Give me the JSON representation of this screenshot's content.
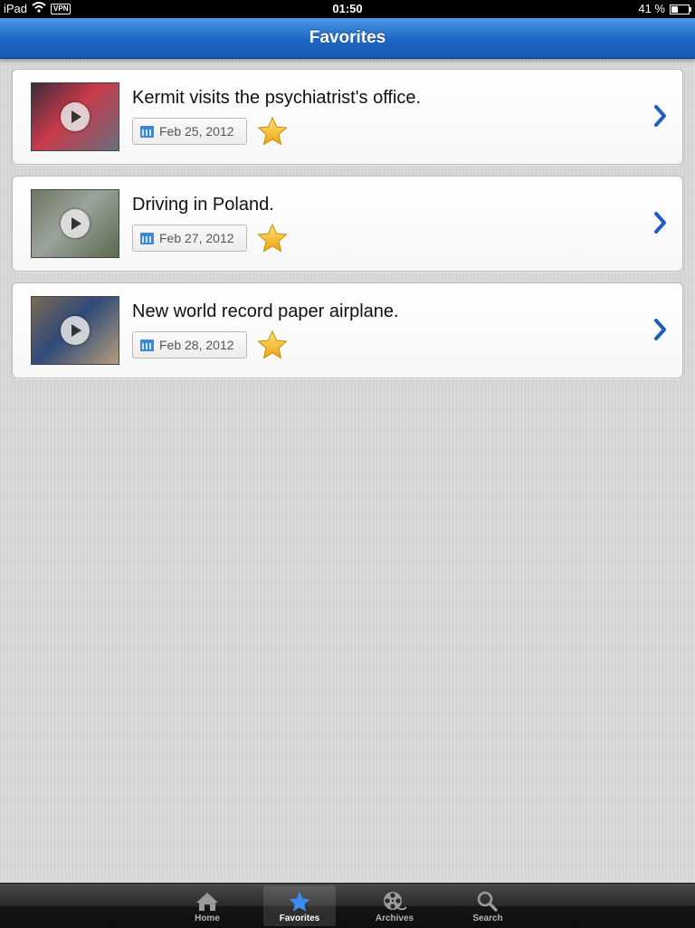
{
  "status_bar": {
    "device": "iPad",
    "vpn": "VPN",
    "time": "01:50",
    "battery": "41 %",
    "battery_level": 0.41
  },
  "nav": {
    "title": "Favorites"
  },
  "favorites": [
    {
      "title": "Kermit visits the psychiatrist's office.",
      "date": "Feb 25, 2012",
      "thumb_colors": [
        "#3b2c3a",
        "#c83a4a",
        "#6a6f7f"
      ]
    },
    {
      "title": "Driving in Poland.",
      "date": "Feb 27, 2012",
      "thumb_colors": [
        "#6c7761",
        "#9aa39a",
        "#5a6a4e"
      ]
    },
    {
      "title": "New world record paper airplane.",
      "date": "Feb 28, 2012",
      "thumb_colors": [
        "#7d6a52",
        "#2f4a7a",
        "#b59d7c"
      ]
    }
  ],
  "tabs": [
    {
      "label": "Home",
      "icon": "home-icon"
    },
    {
      "label": "Favorites",
      "icon": "star-icon",
      "active": true
    },
    {
      "label": "Archives",
      "icon": "film-reel-icon"
    },
    {
      "label": "Search",
      "icon": "magnifier-icon"
    }
  ],
  "colors": {
    "accent": "#1d66c4",
    "star": "#f5b81c",
    "chevron": "#1d5fbf"
  }
}
